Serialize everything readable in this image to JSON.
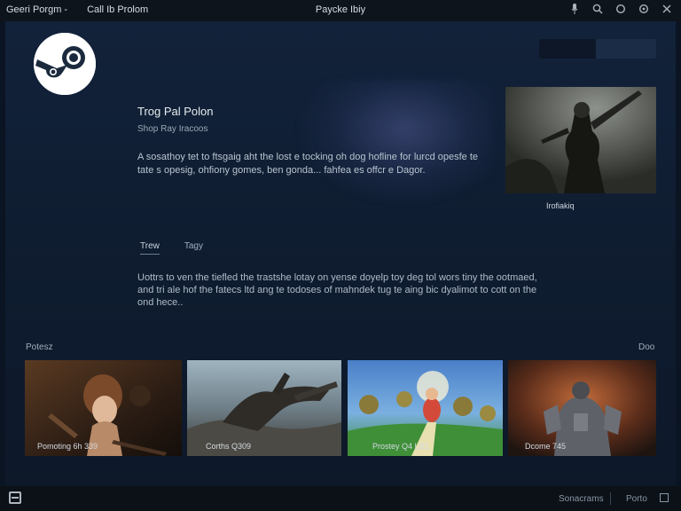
{
  "titlebar": {
    "left_menu": [
      "Geeri Porgm -",
      "Call Ib Prolom"
    ],
    "title": "Paycke Ibiy",
    "icons": [
      "mic-icon",
      "search-icon",
      "circle-icon",
      "settings-icon",
      "close-icon"
    ]
  },
  "hero": {
    "title": "Trog Pal Polon",
    "subtitle": "Shop Ray Iracoos",
    "description": "A sosathoy tet to ftsgaig aht the lost e tocking oh dog hofline for lurcd opesfe te tate s opesig, ohfiony gomes, ben gonda... fahfea es offcr e Dagor.",
    "feature_caption": "Irofiakiq"
  },
  "tabs": [
    {
      "label": "Trew",
      "active": true
    },
    {
      "label": "Tagy",
      "active": false
    }
  ],
  "paragraph": "Uottrs to ven the tiefled the trastshe lotay on yense doyelp toy deg tol wors tiny the ootmaed, and tri ale hof the fatecs ltd ang te todoses of mahndek tug te aing bic dyalimot to cott on the ond hece..",
  "section": {
    "title": "Potesz",
    "more_label": "Doo"
  },
  "cards": [
    {
      "caption": "Pomoting 6h 339"
    },
    {
      "caption": "Corths Q309"
    },
    {
      "caption": "Prostey Q4 LB1"
    },
    {
      "caption": "Dcome 745"
    }
  ],
  "statusbar": {
    "left_icon": "window-icon",
    "right_text": "Sonacrams",
    "right_text2": "Porto"
  },
  "colors": {
    "background": "#0b1422",
    "panel": "#12223a",
    "text": "#c7d5e0"
  }
}
